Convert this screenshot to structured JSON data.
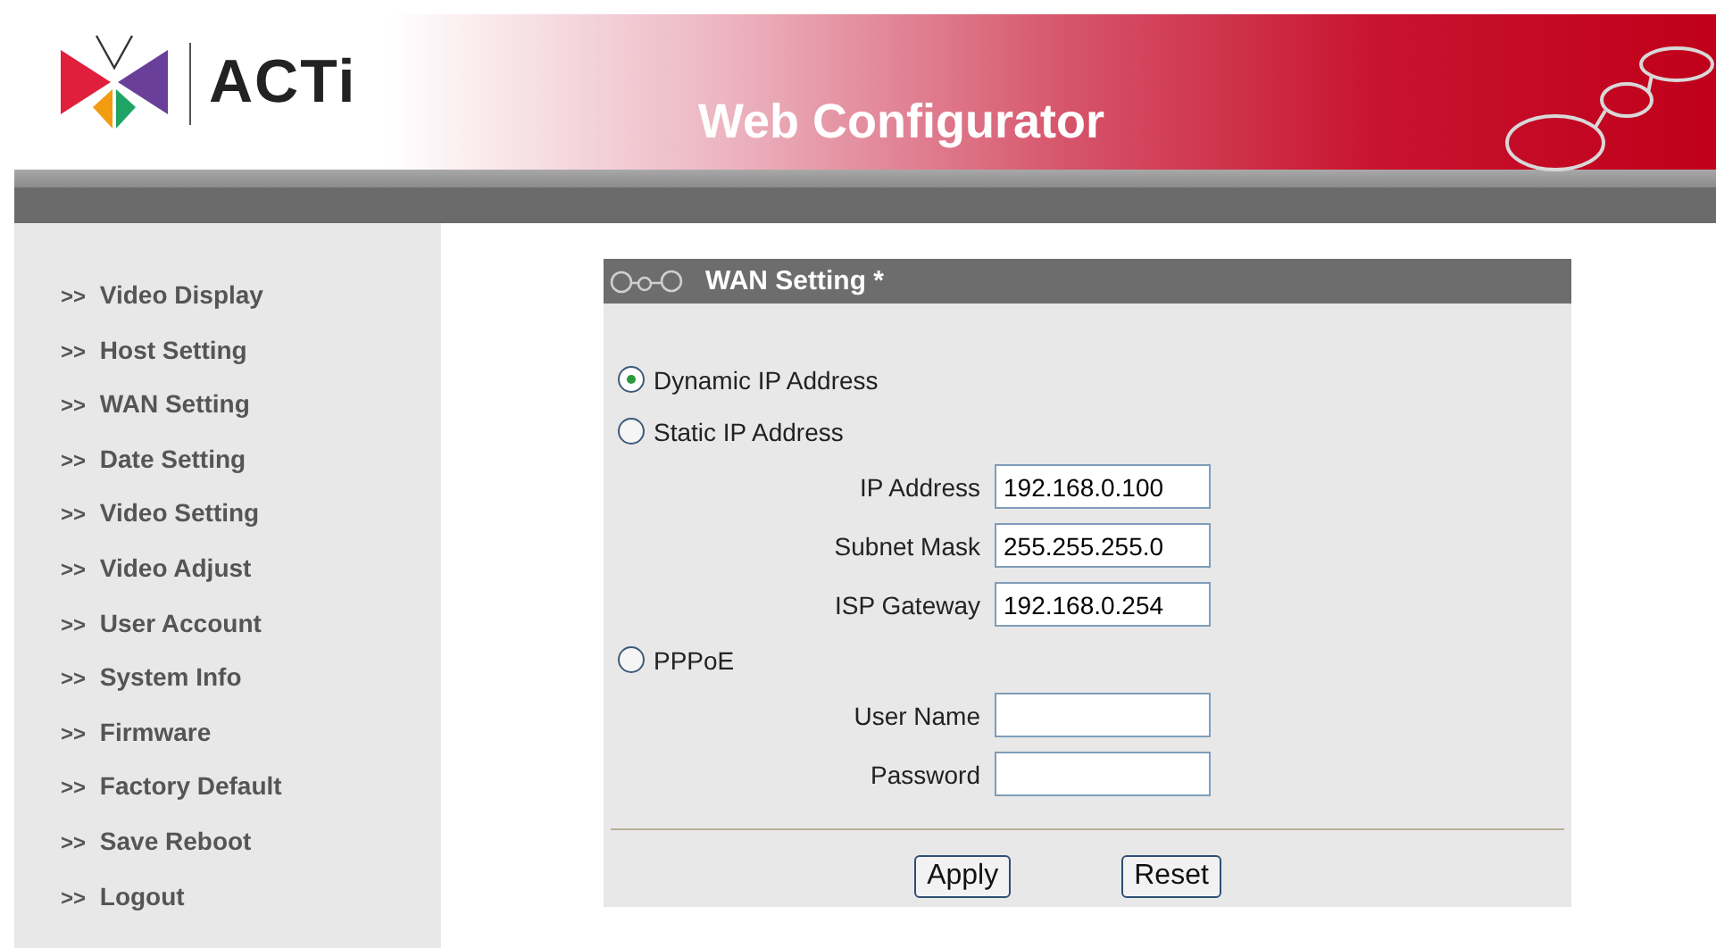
{
  "header": {
    "brand": "ACTi",
    "title": "Web Configurator"
  },
  "sidebar": {
    "items": [
      {
        "marker": ">>",
        "label": "Video Display"
      },
      {
        "marker": ">>",
        "label": "Host Setting"
      },
      {
        "marker": ">>",
        "label": "WAN Setting"
      },
      {
        "marker": ">>",
        "label": "Date Setting"
      },
      {
        "marker": ">>",
        "label": "Video Setting"
      },
      {
        "marker": ">>",
        "label": "Video Adjust"
      },
      {
        "marker": ">>",
        "label": "User Account"
      },
      {
        "marker": ">>",
        "label": "System Info"
      },
      {
        "marker": ">>",
        "label": "Firmware"
      },
      {
        "marker": ">>",
        "label": "Factory Default"
      },
      {
        "marker": ">>",
        "label": "Save Reboot"
      },
      {
        "marker": ">>",
        "label": "Logout"
      }
    ]
  },
  "panel": {
    "title": "WAN Setting *",
    "options": [
      {
        "label": "Dynamic IP Address",
        "selected": true
      },
      {
        "label": "Static IP Address",
        "selected": false,
        "fields": [
          {
            "label": "IP Address",
            "value": "192.168.0.100"
          },
          {
            "label": "Subnet Mask",
            "value": "255.255.255.0"
          },
          {
            "label": "ISP Gateway",
            "value": "192.168.0.254"
          }
        ]
      },
      {
        "label": "PPPoE",
        "selected": false,
        "fields": [
          {
            "label": "User Name"
          },
          {
            "label": "Password"
          }
        ]
      }
    ],
    "buttons": [
      "Apply",
      "Reset"
    ]
  }
}
